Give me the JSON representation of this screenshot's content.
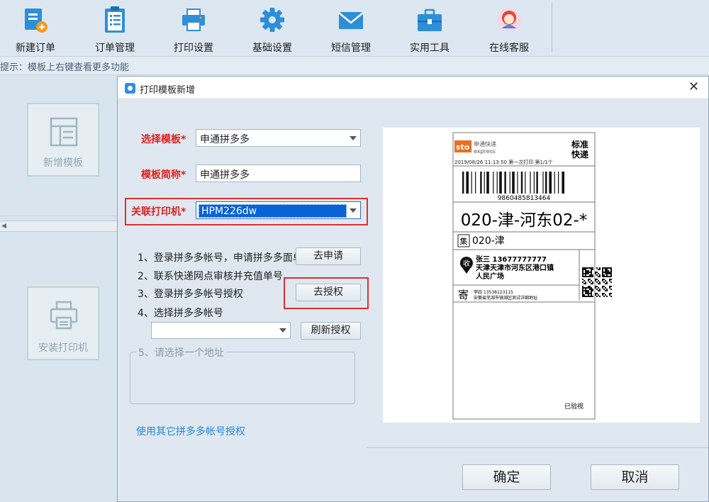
{
  "toolbar": {
    "items": [
      {
        "label": "新建订单",
        "icon": "new-order-icon"
      },
      {
        "label": "订单管理",
        "icon": "clipboard-icon"
      },
      {
        "label": "打印设置",
        "icon": "printer-icon"
      },
      {
        "label": "基础设置",
        "icon": "gear-icon"
      },
      {
        "label": "短信管理",
        "icon": "envelope-icon"
      },
      {
        "label": "实用工具",
        "icon": "toolbox-icon"
      },
      {
        "label": "在线客服",
        "icon": "support-avatar-icon"
      }
    ]
  },
  "hint": "提示：模板上右键查看更多功能",
  "side": {
    "add_template": "新增模板",
    "install_printer": "安装打印机"
  },
  "dialog": {
    "title": "打印模板新增",
    "fields": {
      "template_label": "选择模板*",
      "template_value": "申通拼多多",
      "alias_label": "模板简称*",
      "alias_value": "申通拼多多",
      "printer_label": "关联打印机*",
      "printer_value": "HPM226dw"
    },
    "steps": {
      "s1": "1、登录拼多多帐号，申请拼多多面单",
      "s1_button": "去申请",
      "s2": "2、联系快递网点审核并充值单号",
      "s3": "3、登录拼多多帐号授权",
      "s3_button": "去授权",
      "s4": "4、选择拼多多帐号",
      "s4_select": "",
      "s4_button": "刷新授权",
      "s5": "5、请选择一个地址"
    },
    "other_account_link": "使用其它拼多多帐号授权",
    "ok": "确定",
    "cancel": "取消"
  },
  "label_preview": {
    "brand": "sto",
    "brand_cn": "申通快递",
    "brand_en": "express",
    "service_line1": "标准",
    "service_line2": "快递",
    "print_info": "2019/08/26  11:13:50  第一次打印 第1/1个",
    "tracking_number": "9860485813464",
    "route_code": "020-津-河东02-*",
    "collect_tag": "集",
    "collect_code": "020-津",
    "receiver_tag": "收",
    "receiver_name_phone": "张三  13677777777",
    "receiver_address_1": "天津天津市河东区港口镇",
    "receiver_address_2": "人民广场",
    "sender_tag": "寄",
    "sender_name_phone": "李四  13538123115",
    "sender_address": "安徽省芜湖市镜湖区测试详细地址",
    "inspected": "已验视"
  },
  "colors": {
    "required_label": "#e0201e",
    "link": "#2a86d8",
    "highlight_frame": "#e0302e",
    "selection": "#0a62d8"
  }
}
